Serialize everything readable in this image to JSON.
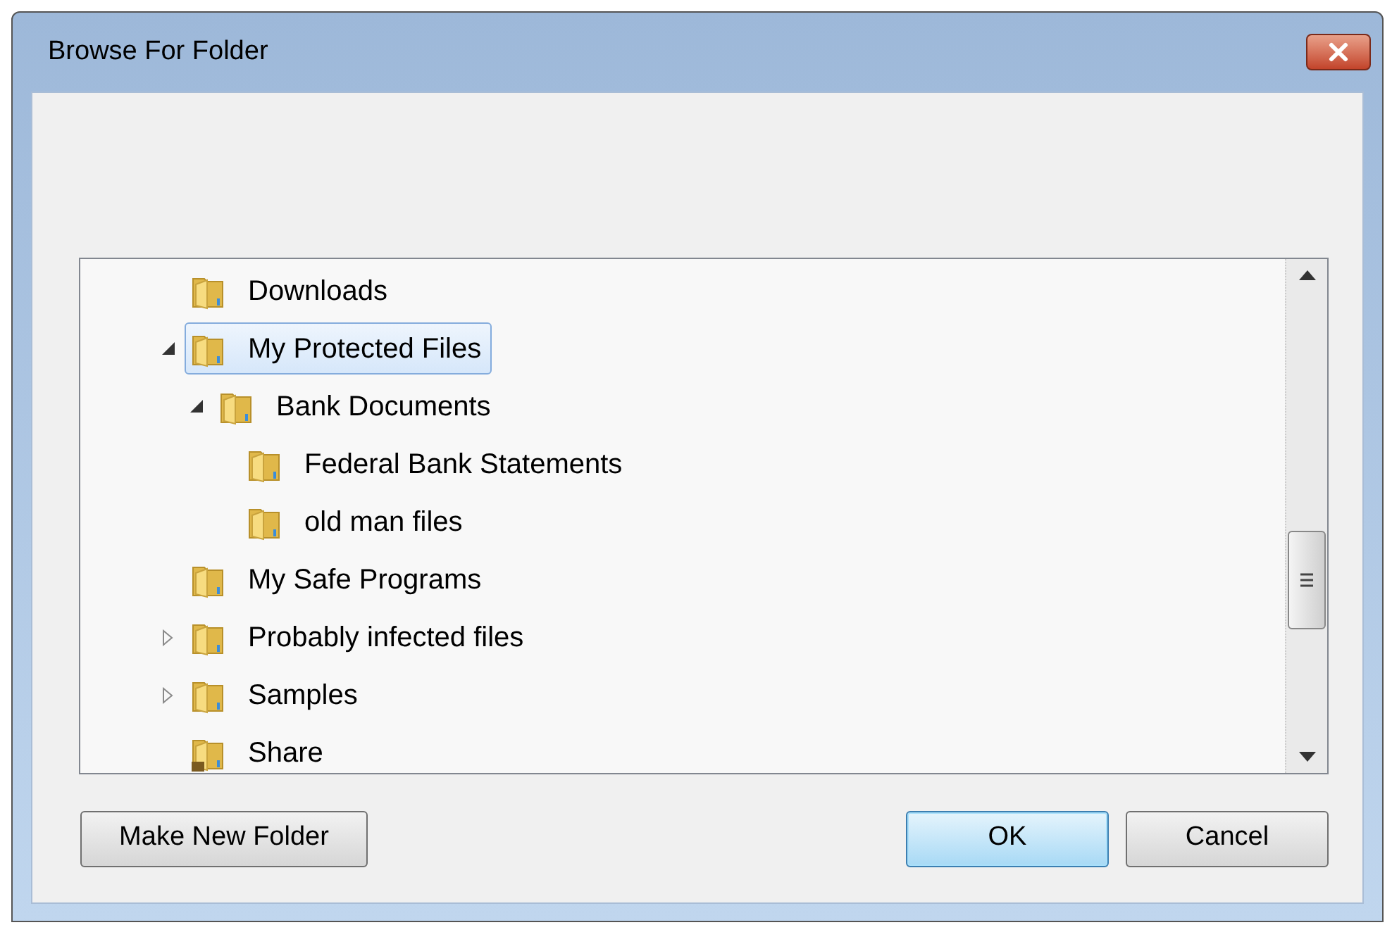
{
  "window": {
    "title": "Browse For Folder"
  },
  "tree": [
    {
      "label": "Downloads",
      "kind": "folder",
      "selected": false
    },
    {
      "label": "My Protected Files",
      "kind": "folder",
      "selected": true,
      "expanded": true,
      "children": [
        {
          "label": "Bank Documents",
          "kind": "folder",
          "selected": false,
          "expanded": true,
          "children": [
            {
              "label": "Federal Bank Statements",
              "kind": "folder",
              "selected": false
            },
            {
              "label": "old man files",
              "kind": "folder",
              "selected": false
            }
          ]
        }
      ]
    },
    {
      "label": "My Safe Programs",
      "kind": "folder",
      "selected": false
    },
    {
      "label": "Probably infected files",
      "kind": "folder",
      "selected": false,
      "expanded": false
    },
    {
      "label": "Samples",
      "kind": "folder",
      "selected": false,
      "expanded": false
    },
    {
      "label": "Share",
      "kind": "shared-folder",
      "selected": false
    }
  ],
  "buttons": [
    {
      "label": "Make New Folder",
      "kind": "normal"
    },
    {
      "label": "OK",
      "kind": "default"
    },
    {
      "label": "Cancel",
      "kind": "normal"
    }
  ]
}
